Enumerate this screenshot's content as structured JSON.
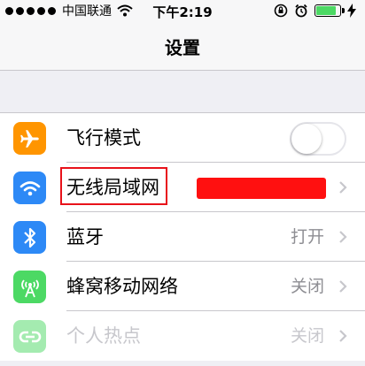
{
  "status_bar": {
    "carrier": "中国联通",
    "time": "下午2:19",
    "battery_level": 0.85,
    "colors": {
      "battery": "#4cd964"
    }
  },
  "nav": {
    "title": "设置"
  },
  "settings": {
    "airplane": {
      "label": "飞行模式",
      "icon": "airplane-icon",
      "toggle_on": false,
      "color": "#ff9500"
    },
    "wifi": {
      "label": "无线局域网",
      "icon": "wifi-icon",
      "color": "#2d89f6"
    },
    "bluetooth": {
      "label": "蓝牙",
      "value": "打开",
      "icon": "bluetooth-icon",
      "color": "#2d89f6"
    },
    "cellular": {
      "label": "蜂窝移动网络",
      "value": "关闭",
      "icon": "antenna-icon",
      "color": "#4cd964"
    },
    "hotspot": {
      "label": "个人热点",
      "value": "关闭",
      "icon": "hotspot-link-icon",
      "color": "#4cd964"
    }
  }
}
